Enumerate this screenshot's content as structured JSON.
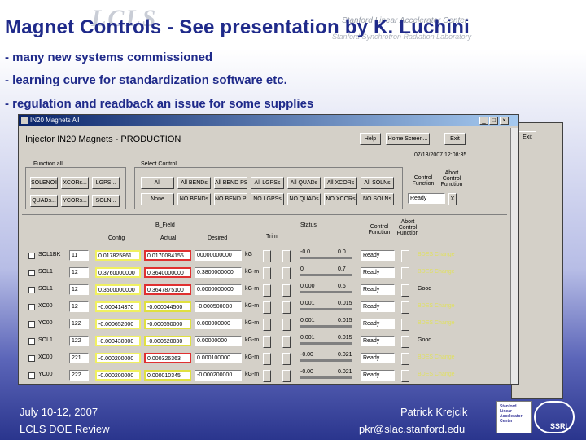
{
  "slide": {
    "title": "Magnet Controls - See presentation by K. Luchini",
    "watermark_logo": "LCLS",
    "watermark_org": "Stanford Linear Accelerator Center",
    "watermark_org2": "Stanford Synchrotron Radiation Laboratory",
    "bullets": [
      "- many new systems commissioned",
      "- learning curve for standardization software etc.",
      "- regulation and readback an issue for some supplies"
    ]
  },
  "app": {
    "window_title": "IN20 Magnets All",
    "panel_title": "Injector IN20 Magnets  -  PRODUCTION",
    "help_button": "Help",
    "home_button": "Home Screen...",
    "exit_button": "Exit",
    "timestamp": "07/13/2007 12:08:35",
    "function_tab": "Function all",
    "select_control_tab": "Select Control",
    "left_buttons": [
      "SOLENOIDs",
      "XCORs...",
      "LGPS...",
      "QUADs...",
      "YCORs...",
      "SOLN..."
    ],
    "select_buttons_row1": [
      "All",
      "All BENDs",
      "All BEND PSs",
      "All LGPSs",
      "All QUADs",
      "All XCORs",
      "All SOLNs"
    ],
    "select_buttons_row2": [
      "None",
      "NO BENDs",
      "NO BEND PSs",
      "NO LGPSs",
      "NO QUADs",
      "NO XCORs",
      "NO SOLNs"
    ],
    "control_function_label": "Control Function",
    "abort_control_label": "Abort Control Function",
    "ready_value": "Ready",
    "abort_x": "X",
    "headers": {
      "config": "Config",
      "bfield": "B_Field",
      "actual": "Actual",
      "desired": "Desired",
      "trim": "Trim",
      "status": "Status",
      "control_function": "Control Function",
      "abort": "Abort Control Function"
    },
    "rows": [
      {
        "name": "SOL1BK",
        "num": "11",
        "config": "0.017825861",
        "actual": "0.0170084155",
        "desired": "00000000000",
        "unit": "kG",
        "range_lo": "-0.0",
        "range_hi": "0.0",
        "fn": "Ready",
        "status": "BDES Change",
        "act_color": "red"
      },
      {
        "name": "SOL1",
        "num": "12",
        "config": "0.3760000000",
        "actual": "0.3640000000",
        "desired": "0.3800000000",
        "unit": "kG-m",
        "range_lo": "0",
        "range_hi": "0.7",
        "fn": "Ready",
        "status": "BDES Change",
        "act_color": "red"
      },
      {
        "name": "SOL1",
        "num": "12",
        "config": "0.3600000000",
        "actual": "0.3647875100",
        "desired": "0.0000000000",
        "unit": "kG-m",
        "range_lo": "0.000",
        "range_hi": "0.6",
        "fn": "Ready",
        "status": "Good",
        "act_color": "red"
      },
      {
        "name": "XC00",
        "num": "12",
        "config": "-0.000414370",
        "actual": "-0.000044500",
        "desired": "-0.000500000",
        "unit": "kG-m",
        "range_lo": "0.001",
        "range_hi": "0.015",
        "fn": "Ready",
        "status": "BDES Change",
        "act_color": "yellow"
      },
      {
        "name": "YC00",
        "num": "122",
        "config": "-0.000652000",
        "actual": "-0.000650000",
        "desired": "0.000000000",
        "unit": "kG-m",
        "range_lo": "0.001",
        "range_hi": "0.015",
        "fn": "Ready",
        "status": "BDES Change",
        "act_color": "yellow"
      },
      {
        "name": "SOL1",
        "num": "122",
        "config": "-0.000430000",
        "actual": "-0.000620030",
        "desired": "0.00000000",
        "unit": "kG-m",
        "range_lo": "0.001",
        "range_hi": "0.015",
        "fn": "Ready",
        "status": "Good",
        "act_color": "yellow"
      },
      {
        "name": "XC00",
        "num": "221",
        "config": "-0.000200000",
        "actual": "0.000326363",
        "desired": "0.000100000",
        "unit": "kG-m",
        "range_lo": "-0.00",
        "range_hi": "0.021",
        "fn": "Ready",
        "status": "BDES Change",
        "act_color": "red"
      },
      {
        "name": "YC00",
        "num": "222",
        "config": "-0.000200000",
        "actual": "0.000010345",
        "desired": "-0.000200000",
        "unit": "kG-m",
        "range_lo": "-0.00",
        "range_hi": "0.021",
        "fn": "Ready",
        "status": "BDES Change",
        "act_color": "yellow"
      }
    ]
  },
  "footer": {
    "date": "July 10-12, 2007",
    "event": "LCLS DOE Review",
    "presenter": "Patrick Krejcik",
    "email": "pkr@slac.stanford.edu",
    "logo_text": "Stanford Linear Accelerator Center",
    "ssrl_text": "SSRL"
  }
}
